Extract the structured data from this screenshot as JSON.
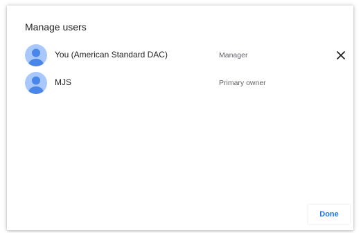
{
  "dialog": {
    "title": "Manage users",
    "done_label": "Done"
  },
  "users": [
    {
      "name": "You (American Standard DAC)",
      "role": "Manager",
      "avatar_icon": "person-avatar-icon",
      "removable": true
    },
    {
      "name": "MJS",
      "role": "Primary owner",
      "avatar_icon": "person-avatar-icon",
      "removable": false
    }
  ],
  "icons": {
    "remove": "close-icon"
  },
  "colors": {
    "accent": "#1a73e8",
    "avatar_bg": "#a8c7fa",
    "avatar_figure": "#4a86e8",
    "text_primary": "#202124",
    "text_secondary": "#5f6368"
  }
}
